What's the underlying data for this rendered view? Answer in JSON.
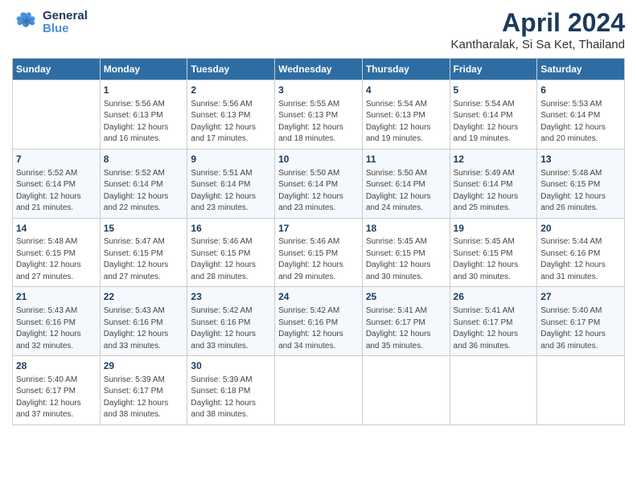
{
  "header": {
    "logo_general": "General",
    "logo_blue": "Blue",
    "title": "April 2024",
    "subtitle": "Kantharalak, Si Sa Ket, Thailand"
  },
  "days_of_week": [
    "Sunday",
    "Monday",
    "Tuesday",
    "Wednesday",
    "Thursday",
    "Friday",
    "Saturday"
  ],
  "weeks": [
    [
      {
        "num": "",
        "info": ""
      },
      {
        "num": "1",
        "info": "Sunrise: 5:56 AM\nSunset: 6:13 PM\nDaylight: 12 hours\nand 16 minutes."
      },
      {
        "num": "2",
        "info": "Sunrise: 5:56 AM\nSunset: 6:13 PM\nDaylight: 12 hours\nand 17 minutes."
      },
      {
        "num": "3",
        "info": "Sunrise: 5:55 AM\nSunset: 6:13 PM\nDaylight: 12 hours\nand 18 minutes."
      },
      {
        "num": "4",
        "info": "Sunrise: 5:54 AM\nSunset: 6:13 PM\nDaylight: 12 hours\nand 19 minutes."
      },
      {
        "num": "5",
        "info": "Sunrise: 5:54 AM\nSunset: 6:14 PM\nDaylight: 12 hours\nand 19 minutes."
      },
      {
        "num": "6",
        "info": "Sunrise: 5:53 AM\nSunset: 6:14 PM\nDaylight: 12 hours\nand 20 minutes."
      }
    ],
    [
      {
        "num": "7",
        "info": "Sunrise: 5:52 AM\nSunset: 6:14 PM\nDaylight: 12 hours\nand 21 minutes."
      },
      {
        "num": "8",
        "info": "Sunrise: 5:52 AM\nSunset: 6:14 PM\nDaylight: 12 hours\nand 22 minutes."
      },
      {
        "num": "9",
        "info": "Sunrise: 5:51 AM\nSunset: 6:14 PM\nDaylight: 12 hours\nand 23 minutes."
      },
      {
        "num": "10",
        "info": "Sunrise: 5:50 AM\nSunset: 6:14 PM\nDaylight: 12 hours\nand 23 minutes."
      },
      {
        "num": "11",
        "info": "Sunrise: 5:50 AM\nSunset: 6:14 PM\nDaylight: 12 hours\nand 24 minutes."
      },
      {
        "num": "12",
        "info": "Sunrise: 5:49 AM\nSunset: 6:14 PM\nDaylight: 12 hours\nand 25 minutes."
      },
      {
        "num": "13",
        "info": "Sunrise: 5:48 AM\nSunset: 6:15 PM\nDaylight: 12 hours\nand 26 minutes."
      }
    ],
    [
      {
        "num": "14",
        "info": "Sunrise: 5:48 AM\nSunset: 6:15 PM\nDaylight: 12 hours\nand 27 minutes."
      },
      {
        "num": "15",
        "info": "Sunrise: 5:47 AM\nSunset: 6:15 PM\nDaylight: 12 hours\nand 27 minutes."
      },
      {
        "num": "16",
        "info": "Sunrise: 5:46 AM\nSunset: 6:15 PM\nDaylight: 12 hours\nand 28 minutes."
      },
      {
        "num": "17",
        "info": "Sunrise: 5:46 AM\nSunset: 6:15 PM\nDaylight: 12 hours\nand 29 minutes."
      },
      {
        "num": "18",
        "info": "Sunrise: 5:45 AM\nSunset: 6:15 PM\nDaylight: 12 hours\nand 30 minutes."
      },
      {
        "num": "19",
        "info": "Sunrise: 5:45 AM\nSunset: 6:15 PM\nDaylight: 12 hours\nand 30 minutes."
      },
      {
        "num": "20",
        "info": "Sunrise: 5:44 AM\nSunset: 6:16 PM\nDaylight: 12 hours\nand 31 minutes."
      }
    ],
    [
      {
        "num": "21",
        "info": "Sunrise: 5:43 AM\nSunset: 6:16 PM\nDaylight: 12 hours\nand 32 minutes."
      },
      {
        "num": "22",
        "info": "Sunrise: 5:43 AM\nSunset: 6:16 PM\nDaylight: 12 hours\nand 33 minutes."
      },
      {
        "num": "23",
        "info": "Sunrise: 5:42 AM\nSunset: 6:16 PM\nDaylight: 12 hours\nand 33 minutes."
      },
      {
        "num": "24",
        "info": "Sunrise: 5:42 AM\nSunset: 6:16 PM\nDaylight: 12 hours\nand 34 minutes."
      },
      {
        "num": "25",
        "info": "Sunrise: 5:41 AM\nSunset: 6:17 PM\nDaylight: 12 hours\nand 35 minutes."
      },
      {
        "num": "26",
        "info": "Sunrise: 5:41 AM\nSunset: 6:17 PM\nDaylight: 12 hours\nand 36 minutes."
      },
      {
        "num": "27",
        "info": "Sunrise: 5:40 AM\nSunset: 6:17 PM\nDaylight: 12 hours\nand 36 minutes."
      }
    ],
    [
      {
        "num": "28",
        "info": "Sunrise: 5:40 AM\nSunset: 6:17 PM\nDaylight: 12 hours\nand 37 minutes."
      },
      {
        "num": "29",
        "info": "Sunrise: 5:39 AM\nSunset: 6:17 PM\nDaylight: 12 hours\nand 38 minutes."
      },
      {
        "num": "30",
        "info": "Sunrise: 5:39 AM\nSunset: 6:18 PM\nDaylight: 12 hours\nand 38 minutes."
      },
      {
        "num": "",
        "info": ""
      },
      {
        "num": "",
        "info": ""
      },
      {
        "num": "",
        "info": ""
      },
      {
        "num": "",
        "info": ""
      }
    ]
  ]
}
